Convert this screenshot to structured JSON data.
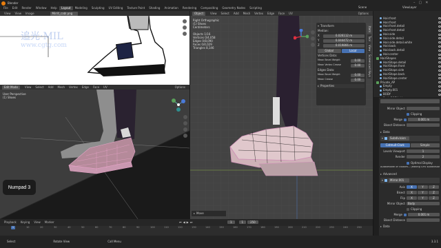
{
  "topbar": {
    "app": "Blender",
    "menus": [
      "File",
      "Edit",
      "Render",
      "Window",
      "Help"
    ],
    "workspaces": [
      "Layout",
      "Modeling",
      "Sculpting",
      "UV Editing",
      "Texture Paint",
      "Shading",
      "Animation",
      "Rendering",
      "Compositing",
      "Geometry Nodes",
      "Scripting"
    ],
    "active_workspace": "Layout",
    "scene": "Scene",
    "view_layer": "ViewLayer"
  },
  "image_editor": {
    "menus": [
      "View",
      "View",
      "Image"
    ],
    "image_name": "Mirrit_cabl.png"
  },
  "watermark": {
    "line1": "追光·MIL",
    "line2": "www.cgtg.com"
  },
  "left_viewport": {
    "mode": "Edit Mode",
    "menus": [
      "View",
      "Select",
      "Add",
      "Mesh",
      "Vertex",
      "Edge",
      "Face",
      "UV"
    ],
    "overlay_text": [
      "User Perspective",
      "(1) Shoes"
    ],
    "options": "Options",
    "key_hint": "Numpad 3"
  },
  "right_viewport": {
    "mode": "Object",
    "menus": [
      "View",
      "Select",
      "Add",
      "Mesh",
      "Vertex",
      "Edge",
      "Face",
      "UV"
    ],
    "overlay_text": [
      "Right Orthographic",
      "(1) Shoes",
      "Centimeters",
      "",
      "Objects  1/16",
      "Vertices  0/4,058",
      "Edges  0/8,090",
      "Faces  0/4,029",
      "Triangles  8,146"
    ],
    "options": "Options",
    "footer": "Move"
  },
  "npanel": {
    "transform_header": "Transform",
    "median_label": "Median:",
    "axes": [
      {
        "axis": "X",
        "value": "0.026112 m"
      },
      {
        "axis": "Y",
        "value": "0.044472 m"
      },
      {
        "axis": "Z",
        "value": "0.019866 m"
      }
    ],
    "toggle": [
      "Global",
      "Local"
    ],
    "vertices_data": "Vertices Data:",
    "v_rows": [
      {
        "label": "Mean Bevel Weight",
        "value": "0.00"
      },
      {
        "label": "Mean Vertex Crease",
        "value": "0.00"
      }
    ],
    "edges_data": "Edges Data:",
    "e_rows": [
      {
        "label": "Mean Bevel Weight",
        "value": "0.00"
      },
      {
        "label": "Mean Crease",
        "value": "0.00"
      }
    ],
    "properties_header": "Properties",
    "tabs": [
      "Item",
      "Tool",
      "View",
      "Screencast Keys"
    ]
  },
  "outliner": {
    "items": [
      {
        "name": "Hair.front",
        "indent": 1
      },
      {
        "name": "Hair.front",
        "indent": 1
      },
      {
        "name": "Hair.front.detail",
        "indent": 1
      },
      {
        "name": "Hair.front.detail",
        "indent": 1
      },
      {
        "name": "Hair.side",
        "indent": 1
      },
      {
        "name": "Hair.side.detail",
        "indent": 1
      },
      {
        "name": "Hair.side.detail.white",
        "indent": 1
      },
      {
        "name": "Hair.back",
        "indent": 1
      },
      {
        "name": "Hair.back.detail",
        "indent": 1
      },
      {
        "name": "Hair.center",
        "indent": 1
      },
      {
        "name": "HairShapes",
        "indent": 0
      },
      {
        "name": "HairShape.detail",
        "indent": 1
      },
      {
        "name": "HairShape.front",
        "indent": 1
      },
      {
        "name": "HairShape.side",
        "indent": 1
      },
      {
        "name": "HairShape.back",
        "indent": 1
      },
      {
        "name": "HairShape.center",
        "indent": 1
      },
      {
        "name": "Private_AP",
        "indent": 0
      },
      {
        "name": "Empty",
        "indent": 1
      },
      {
        "name": "Empty.001",
        "indent": 1
      },
      {
        "name": "BODY",
        "indent": 1
      },
      {
        "name": "Body.BODY.side",
        "indent": 1
      }
    ]
  },
  "properties": {
    "mirror_object_label": "Mirror Object",
    "clipping": "Clipping",
    "merge_label": "Merge",
    "merge_value": "0.001 m",
    "bisect_distance": "Bisect Distance",
    "data_label": "Data",
    "subdiv_name": "Subdivision",
    "subdiv_modes": [
      "Catmull-Clark",
      "Simple"
    ],
    "levels_viewport": {
      "label": "Levels Viewport",
      "value": "1"
    },
    "render": {
      "label": "Render",
      "value": "2"
    },
    "optimal_display": "Optimal Display",
    "subdiv_note": "Autosmooth or custom... (editing GPU subdivision)",
    "advanced": "Advanced",
    "mirror_name": "Mirror.001",
    "axis_rows": [
      {
        "label": "Axis",
        "vals": [
          "X",
          "Y",
          "Z"
        ]
      },
      {
        "label": "Bisect",
        "vals": [
          "X",
          "Y",
          "Z"
        ]
      },
      {
        "label": "Flip",
        "vals": [
          "X",
          "Y",
          "Z"
        ]
      }
    ],
    "mirror_object2": {
      "label": "Mirror Object",
      "value": "Body"
    },
    "clipping2": "Clipping",
    "merge2": {
      "label": "Merge",
      "value": "0.001 m"
    },
    "bisect2": "Bisect Distance",
    "data2": "Data"
  },
  "timeline": {
    "menus": [
      "Playback",
      "Keying",
      "View",
      "Marker"
    ],
    "frame": "1",
    "start": "1",
    "end": "250",
    "ticks": [
      "0",
      "10",
      "20",
      "30",
      "40",
      "50",
      "60",
      "70",
      "80",
      "90",
      "100",
      "110",
      "120",
      "130",
      "140",
      "150",
      "160",
      "170",
      "180",
      "190",
      "200",
      "210",
      "220",
      "230",
      "240",
      "250"
    ]
  },
  "statusbar": {
    "items": [
      "Select",
      "Rotate View",
      "Call Menu"
    ],
    "version": "3.3.1"
  },
  "colors": {
    "accent": "#4772b3",
    "bg": "#1d1d1d",
    "panel": "#2b2b2b",
    "viewport": "#3d3d3d"
  }
}
